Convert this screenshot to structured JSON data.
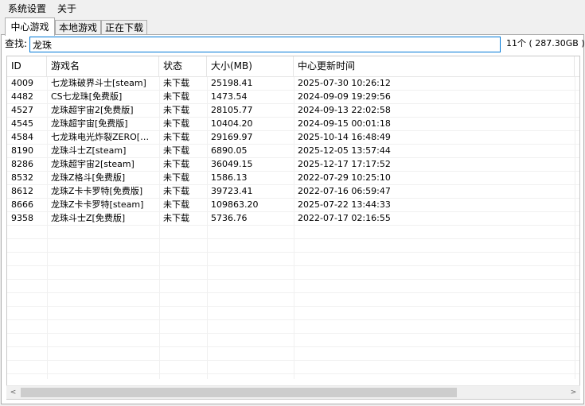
{
  "menu": [
    "系统设置",
    "关于"
  ],
  "tabs": [
    "中心游戏",
    "本地游戏",
    "正在下载"
  ],
  "search": {
    "label": "查找:",
    "value": "龙珠"
  },
  "summary": "11个 ( 287.30GB )",
  "table": {
    "columns": [
      "ID",
      "游戏名",
      "状态",
      "大小(MB)",
      "中心更新时间"
    ],
    "rows": [
      [
        "4009",
        "七龙珠破界斗士[steam]",
        "未下载",
        "25198.41",
        "2025-07-30 10:26:12"
      ],
      [
        "4482",
        "CS七龙珠[免费版]",
        "未下载",
        "1473.54",
        "2024-09-09 19:29:56"
      ],
      [
        "4527",
        "龙珠超宇宙2[免费版]",
        "未下载",
        "28105.77",
        "2024-09-13 22:02:58"
      ],
      [
        "4545",
        "龙珠超宇宙[免费版]",
        "未下载",
        "10404.20",
        "2024-09-15 00:01:18"
      ],
      [
        "4584",
        "七龙珠电光炸裂ZERO[…",
        "未下载",
        "29169.97",
        "2025-10-14 16:48:49"
      ],
      [
        "8190",
        "龙珠斗士Z[steam]",
        "未下载",
        "6890.05",
        "2025-12-05 13:57:44"
      ],
      [
        "8286",
        "龙珠超宇宙2[steam]",
        "未下载",
        "36049.15",
        "2025-12-17 17:17:52"
      ],
      [
        "8532",
        "龙珠Z格斗[免费版]",
        "未下载",
        "1586.13",
        "2022-07-29 10:25:10"
      ],
      [
        "8612",
        "龙珠Z卡卡罗特[免费版]",
        "未下载",
        "39723.41",
        "2022-07-16 06:59:47"
      ],
      [
        "8666",
        "龙珠Z卡卡罗特[steam]",
        "未下载",
        "109863.20",
        "2025-07-22 13:44:33"
      ],
      [
        "9358",
        "龙珠斗士Z[免费版]",
        "未下载",
        "5736.76",
        "2022-07-17 02:16:55"
      ]
    ]
  },
  "scrollbar": {
    "left_arrow": "<",
    "right_arrow": ">",
    "left_icon": "chevron-left-icon",
    "right_icon": "chevron-right-icon"
  },
  "colors": {
    "selected_border": "#0078d7",
    "window_bg": "#f0f0f0"
  }
}
